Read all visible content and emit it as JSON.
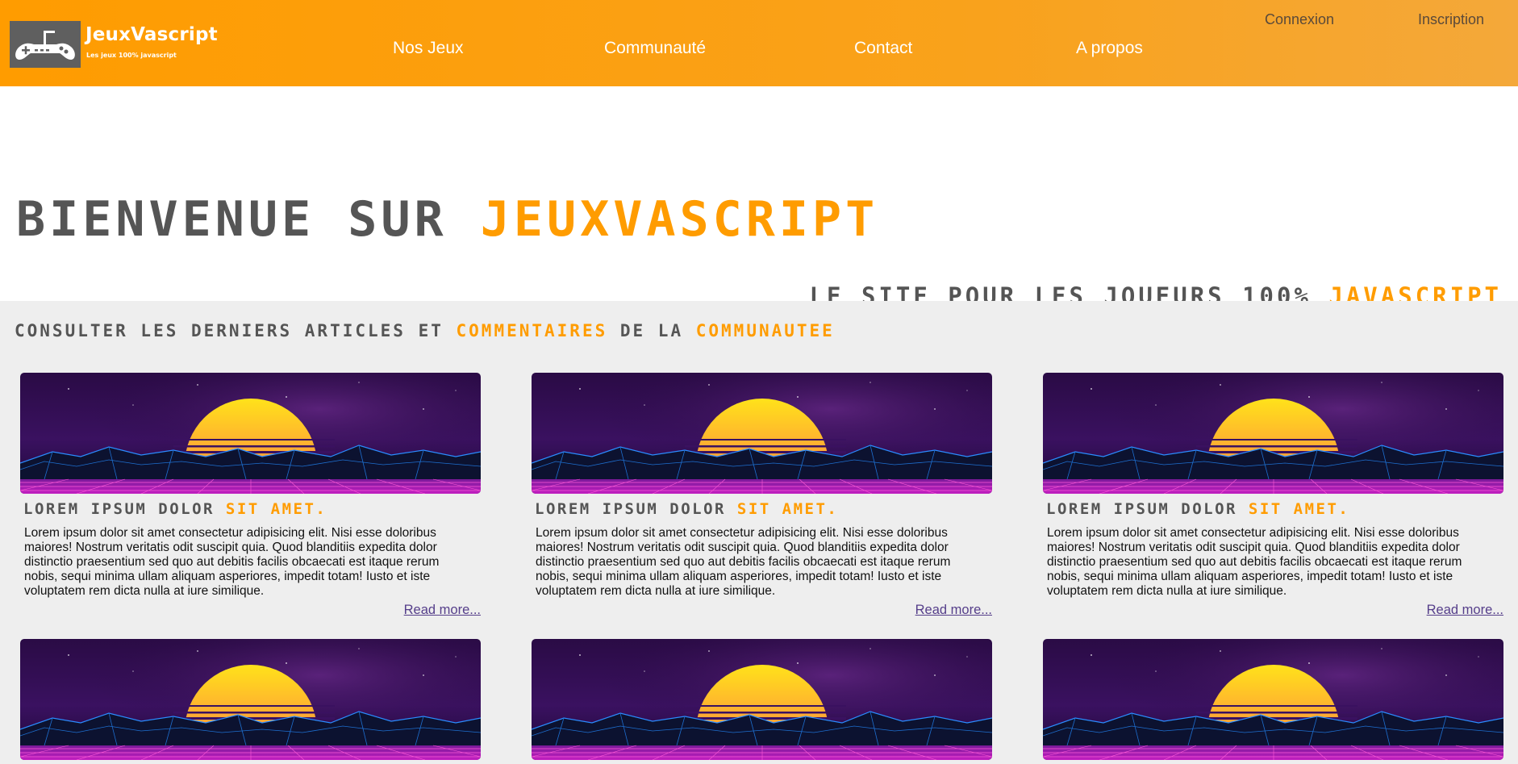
{
  "header": {
    "brand_title": "JeuxVascript",
    "brand_tagline": "Les jeux 100% javascript",
    "logo_icon": "gamepad-icon",
    "nav": [
      {
        "label": "Nos Jeux"
      },
      {
        "label": "Communauté"
      },
      {
        "label": "Contact"
      },
      {
        "label": "A propos"
      }
    ],
    "auth": {
      "login": "Connexion",
      "register": "Inscription"
    },
    "colors": {
      "accent": "#ff9c00",
      "logo_bg": "#5f5f5f"
    }
  },
  "hero": {
    "title_part1": "Bienvenue sur ",
    "title_part2": "JeuxVascript",
    "subtitle_part1": "Le site pour les joueurs 100% ",
    "subtitle_part2": "Javascript"
  },
  "articles": {
    "heading_part1": "Consulter les derniers articles et ",
    "heading_part2": "commentaires",
    "heading_part3": " de la ",
    "heading_part4": "communautee",
    "cards": [
      {
        "title_part1": "Lorem ipsum dolor ",
        "title_part2": "sit amet.",
        "text": "Lorem ipsum dolor sit amet consectetur adipisicing elit. Nisi esse doloribus maiores! Nostrum veritatis odit suscipit quia. Quod blanditiis expedita dolor distinctio praesentium sed quo aut debitis facilis obcaecati est itaque rerum nobis, sequi minima ullam aliquam asperiores, impedit totam! Iusto et iste voluptatem rem dicta nulla at iure similique.",
        "read_more": "Read more..."
      },
      {
        "title_part1": "Lorem ipsum dolor ",
        "title_part2": "sit amet.",
        "text": "Lorem ipsum dolor sit amet consectetur adipisicing elit. Nisi esse doloribus maiores! Nostrum veritatis odit suscipit quia. Quod blanditiis expedita dolor distinctio praesentium sed quo aut debitis facilis obcaecati est itaque rerum nobis, sequi minima ullam aliquam asperiores, impedit totam! Iusto et iste voluptatem rem dicta nulla at iure similique.",
        "read_more": "Read more..."
      },
      {
        "title_part1": "Lorem ipsum dolor ",
        "title_part2": "sit amet.",
        "text": "Lorem ipsum dolor sit amet consectetur adipisicing elit. Nisi esse doloribus maiores! Nostrum veritatis odit suscipit quia. Quod blanditiis expedita dolor distinctio praesentium sed quo aut debitis facilis obcaecati est itaque rerum nobis, sequi minima ullam aliquam asperiores, impedit totam! Iusto et iste voluptatem rem dicta nulla at iure similique.",
        "read_more": "Read more..."
      }
    ]
  }
}
